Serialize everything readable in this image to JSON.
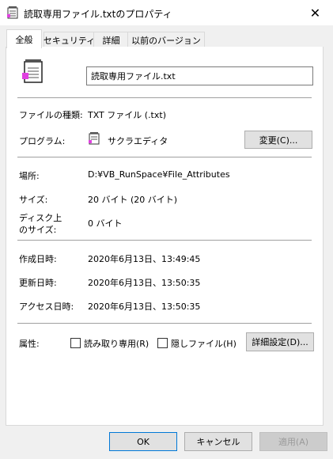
{
  "window": {
    "title": "読取専用ファイル.txtのプロパティ",
    "close_glyph": "✕"
  },
  "tabs": [
    {
      "label": "全般",
      "active": true
    },
    {
      "label": "セキュリティ",
      "active": false
    },
    {
      "label": "詳細",
      "active": false
    },
    {
      "label": "以前のバージョン",
      "active": false
    }
  ],
  "general": {
    "filename": "読取専用ファイル.txt",
    "file_type_label": "ファイルの種類:",
    "file_type_value": "TXT ファイル (.txt)",
    "program_label": "プログラム:",
    "program_value": "サクラエディタ",
    "change_button": "変更(C)...",
    "location_label": "場所:",
    "location_value": "D:¥VB_RunSpace¥File_Attributes",
    "size_label": "サイズ:",
    "size_value": "20 バイト (20 バイト)",
    "disk_size_label_1": "ディスク上",
    "disk_size_label_2": "のサイズ:",
    "disk_size_value": "0 バイト",
    "created_label": "作成日時:",
    "created_value": "2020年6月13日、13:49:45",
    "modified_label": "更新日時:",
    "modified_value": "2020年6月13日、13:50:35",
    "accessed_label": "アクセス日時:",
    "accessed_value": "2020年6月13日、13:50:35",
    "attributes_label": "属性:",
    "readonly_label": "読み取り専用(R)",
    "readonly_checked": false,
    "hidden_label": "隠しファイル(H)",
    "hidden_checked": false,
    "advanced_button": "詳細設定(D)..."
  },
  "footer": {
    "ok": "OK",
    "cancel": "キャンセル",
    "apply": "適用(A)"
  }
}
